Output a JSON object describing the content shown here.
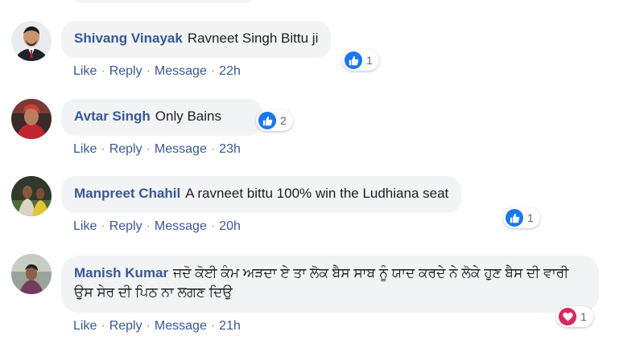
{
  "comments": [
    {
      "author": "Shivang Vinayak",
      "text": "Ravneet Singh Bittu ji",
      "actions": {
        "like": "Like",
        "reply": "Reply",
        "message": "Message",
        "time": "22h"
      },
      "reaction": {
        "type": "like-icon",
        "count": "1"
      }
    },
    {
      "author": "Avtar Singh",
      "text": "Only Bains",
      "actions": {
        "like": "Like",
        "reply": "Reply",
        "message": "Message",
        "time": "23h"
      },
      "reaction": {
        "type": "like-icon",
        "count": "2"
      }
    },
    {
      "author": "Manpreet Chahil",
      "text": "A ravneet bittu 100% win the Ludhiana seat",
      "actions": {
        "like": "Like",
        "reply": "Reply",
        "message": "Message",
        "time": "20h"
      },
      "reaction": {
        "type": "like-icon",
        "count": "1"
      }
    },
    {
      "author": "Manish Kumar",
      "text": "ਜਦੋ ਕੋਈ ਕੰਮ ਅੜਦਾ ਏ ਤਾ ਲੋਕ ਬੈਸ ਸਾਬ ਨੂੰ ਯਾਦ ਕਰਦੇ ਨੇ ਲੋਕੇ ਹੁਣ ਬੈਸ ਦੀ ਵਾਰੀ ਉਸ ਸੇਰ ਦੀ ਪਿਠ ਨਾ ਲਗਣ ਦਿਉ",
      "actions": {
        "like": "Like",
        "reply": "Reply",
        "message": "Message",
        "time": "21h"
      },
      "reaction": {
        "type": "love-icon",
        "count": "1"
      }
    }
  ],
  "colors": {
    "link": "#385898",
    "bubble": "#f2f3f5",
    "like": "#1877f2",
    "love": "#e0245e"
  }
}
